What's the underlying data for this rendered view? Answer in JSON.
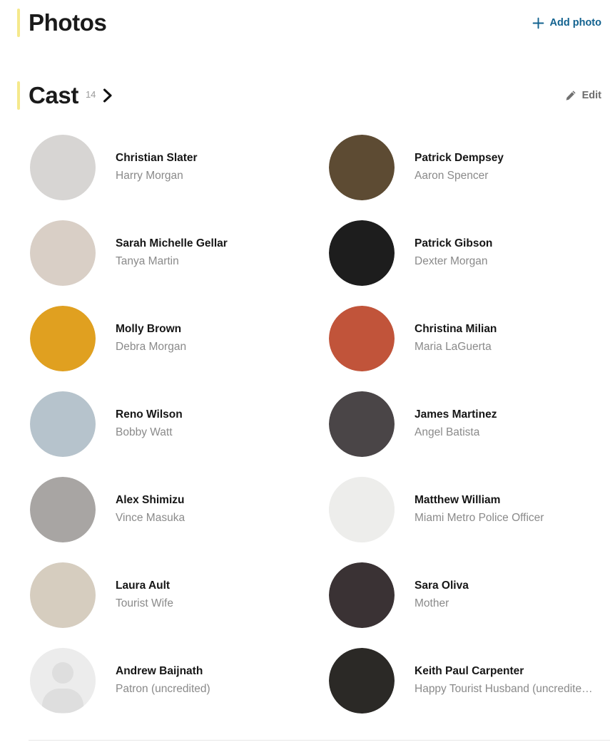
{
  "photos": {
    "title": "Photos",
    "add_label": "Add photo",
    "add_icon": "plus-icon"
  },
  "cast": {
    "title": "Cast",
    "count": "14",
    "chevron_icon": "chevron-right-icon",
    "edit_label": "Edit",
    "edit_icon": "pencil-icon",
    "members": [
      {
        "name": "Christian Slater",
        "role": "Harry Morgan",
        "avatar_type": "photo",
        "avatar_bg": "#d7d5d3"
      },
      {
        "name": "Patrick Dempsey",
        "role": "Aaron Spencer",
        "avatar_type": "photo",
        "avatar_bg": "#5d4b33"
      },
      {
        "name": "Sarah Michelle Gellar",
        "role": "Tanya Martin",
        "avatar_type": "photo",
        "avatar_bg": "#d9cfc6"
      },
      {
        "name": "Patrick Gibson",
        "role": "Dexter Morgan",
        "avatar_type": "photo",
        "avatar_bg": "#1d1d1d"
      },
      {
        "name": "Molly Brown",
        "role": "Debra Morgan",
        "avatar_type": "photo",
        "avatar_bg": "#e0a020"
      },
      {
        "name": "Christina Milian",
        "role": "Maria LaGuerta",
        "avatar_type": "photo",
        "avatar_bg": "#c1543a"
      },
      {
        "name": "Reno Wilson",
        "role": "Bobby Watt",
        "avatar_type": "photo",
        "avatar_bg": "#b6c3cc"
      },
      {
        "name": "James Martinez",
        "role": "Angel Batista",
        "avatar_type": "photo",
        "avatar_bg": "#4a4547"
      },
      {
        "name": "Alex Shimizu",
        "role": "Vince Masuka",
        "avatar_type": "photo",
        "avatar_bg": "#a8a5a3"
      },
      {
        "name": "Matthew William",
        "role": "Miami Metro Police Officer",
        "avatar_type": "photo",
        "avatar_bg": "#ededeb"
      },
      {
        "name": "Laura Ault",
        "role": "Tourist Wife",
        "avatar_type": "photo",
        "avatar_bg": "#d6cdbf"
      },
      {
        "name": "Sara Oliva",
        "role": "Mother",
        "avatar_type": "photo",
        "avatar_bg": "#3a3234"
      },
      {
        "name": "Andrew Baijnath",
        "role": "Patron (uncredited)",
        "avatar_type": "placeholder",
        "avatar_bg": "#ececec"
      },
      {
        "name": "Keith Paul Carpenter",
        "role": "Happy Tourist Husband (uncredite…",
        "avatar_type": "photo",
        "avatar_bg": "#2b2926"
      }
    ]
  },
  "colors": {
    "accent_bar": "#f5e98c",
    "link": "#12628f",
    "muted_text": "#8a8a8a",
    "name_text": "#161616"
  }
}
